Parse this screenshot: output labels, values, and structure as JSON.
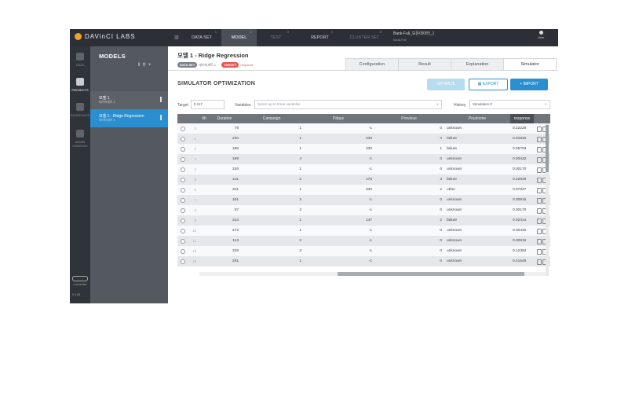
{
  "app": {
    "brand": "DAVinCI LABS",
    "project_name": "Bank-Full_모든데이터_1",
    "project_sub": "bank-Full",
    "user_label": "User"
  },
  "topnav": [
    {
      "num": "1",
      "label": "DATA SET"
    },
    {
      "num": "2",
      "label": "MODEL"
    },
    {
      "num": "3",
      "label": "TEST"
    },
    {
      "num": "4",
      "label": "REPORT"
    },
    {
      "num": "5",
      "label": "CLUSTER SET"
    }
  ],
  "rail": [
    {
      "label": "DATA",
      "icon": "database-icon"
    },
    {
      "label": "PROJECTS",
      "icon": "cube-icon"
    },
    {
      "label": "SCHEDULES",
      "icon": "box-icon"
    },
    {
      "label": "ADMIN CONSOLE",
      "icon": "stack-icon"
    }
  ],
  "connection": {
    "status": "Connected",
    "version": "V 1.02"
  },
  "models_panel": {
    "title": "MODELS",
    "items": [
      {
        "name": "모델 1",
        "sub": "데이터세트 1"
      },
      {
        "name": "모델 1 - Ridge Regression",
        "sub": "데이터세트 1"
      }
    ]
  },
  "main": {
    "title": "모델 1 - Ridge Regression",
    "dataset_badge": "DATA SET",
    "dataset_value": "데이터세트 1",
    "target_badge": "TARGET",
    "target_value": "response",
    "tabs": [
      "Configuration",
      "Result",
      "Explanation",
      "Simulator"
    ],
    "active_tab": "Simulator",
    "section_title": "SIMULATOR OPTIMIZATION",
    "buttons": {
      "optimize": "OPTIMIZE",
      "export": "EXPORT",
      "import": "+ IMPORT"
    },
    "target_label": "Target",
    "target_input": "0.117",
    "variables_label": "Variables",
    "variables_placeholder": "Select up to three variables",
    "history_label": "History",
    "history_value": "Simulation 0"
  },
  "table": {
    "columns": [
      "ith",
      "Duration",
      "Campaign",
      "Pdays",
      "Previous",
      "Poutcome",
      "response"
    ],
    "rows": [
      {
        "i": "0",
        "ith": "",
        "duration": "79",
        "campaign": "1",
        "pdays": "-1",
        "previous": "0",
        "poutcome": "unknown",
        "response": "0.22229"
      },
      {
        "i": "1",
        "ith": "",
        "duration": "220",
        "campaign": "1",
        "pdays": "339",
        "previous": "4",
        "poutcome": "failure",
        "response": "0.01825"
      },
      {
        "i": "2",
        "ith": "",
        "duration": "185",
        "campaign": "1",
        "pdays": "330",
        "previous": "1",
        "poutcome": "failure",
        "response": "0.05793"
      },
      {
        "i": "3",
        "ith": "",
        "duration": "199",
        "campaign": "4",
        "pdays": "-1",
        "previous": "0",
        "poutcome": "unknown",
        "response": "0.00432"
      },
      {
        "i": "4",
        "ith": "",
        "duration": "226",
        "campaign": "1",
        "pdays": "-1",
        "previous": "0",
        "poutcome": "unknown",
        "response": "0.00170"
      },
      {
        "i": "5",
        "ith": "",
        "duration": "141",
        "campaign": "2",
        "pdays": "176",
        "previous": "3",
        "poutcome": "failure",
        "response": "0.22828"
      },
      {
        "i": "6",
        "ith": "",
        "duration": "341",
        "campaign": "1",
        "pdays": "330",
        "previous": "2",
        "poutcome": "other",
        "response": "0.07827"
      },
      {
        "i": "7",
        "ith": "",
        "duration": "151",
        "campaign": "2",
        "pdays": "-1",
        "previous": "0",
        "poutcome": "unknown",
        "response": "0.00915"
      },
      {
        "i": "8",
        "ith": "",
        "duration": "57",
        "campaign": "2",
        "pdays": "-1",
        "previous": "0",
        "poutcome": "unknown",
        "response": "0.00170"
      },
      {
        "i": "9",
        "ith": "",
        "duration": "313",
        "campaign": "1",
        "pdays": "147",
        "previous": "2",
        "poutcome": "failure",
        "response": "0.02414"
      },
      {
        "i": "10",
        "ith": "",
        "duration": "273",
        "campaign": "1",
        "pdays": "-1",
        "previous": "0",
        "poutcome": "unknown",
        "response": "0.00432"
      },
      {
        "i": "11",
        "ith": "",
        "duration": "113",
        "campaign": "2",
        "pdays": "-1",
        "previous": "0",
        "poutcome": "unknown",
        "response": "0.00916"
      },
      {
        "i": "12",
        "ith": "",
        "duration": "328",
        "campaign": "2",
        "pdays": "-1",
        "previous": "0",
        "poutcome": "unknown",
        "response": "0.12382"
      },
      {
        "i": "13",
        "ith": "",
        "duration": "261",
        "campaign": "1",
        "pdays": "-1",
        "previous": "0",
        "poutcome": "unknown",
        "response": "0.41549"
      }
    ]
  },
  "colors": {
    "accent": "#2a8fd0",
    "target_badge": "#e6564f",
    "topbar": "#2c3036",
    "panel": "#54585f"
  }
}
